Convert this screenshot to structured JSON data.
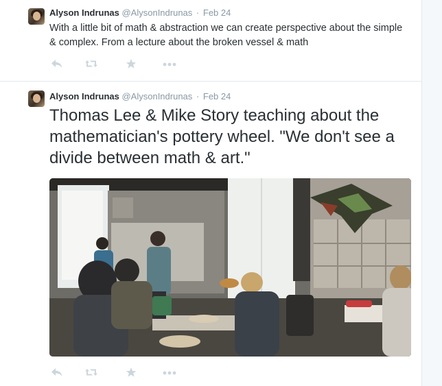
{
  "tweets": [
    {
      "fullname": "Alyson Indrunas",
      "username": "@AlysonIndrunas",
      "separator": "·",
      "time": "Feb 24",
      "text": "With a little bit of math & abstraction we can create perspective about the simple & complex. From a lecture about the broken vessel & math",
      "actions": [
        "reply-icon",
        "retweet-icon",
        "favorite-icon",
        "more-icon"
      ]
    },
    {
      "fullname": "Alyson Indrunas",
      "username": "@AlysonIndrunas",
      "separator": "·",
      "time": "Feb 24",
      "text": "Thomas Lee & Mike Story teaching about the mathematician's pottery wheel. \"We don't see a divide between math & art.\"",
      "media": "classroom-photo",
      "actions": [
        "reply-icon",
        "retweet-icon",
        "favorite-icon",
        "more-icon"
      ]
    }
  ],
  "colors": {
    "link_gray": "#8899a6",
    "text": "#292f33",
    "action_icon": "#ccd6dd",
    "divider": "#e1e8ed"
  }
}
